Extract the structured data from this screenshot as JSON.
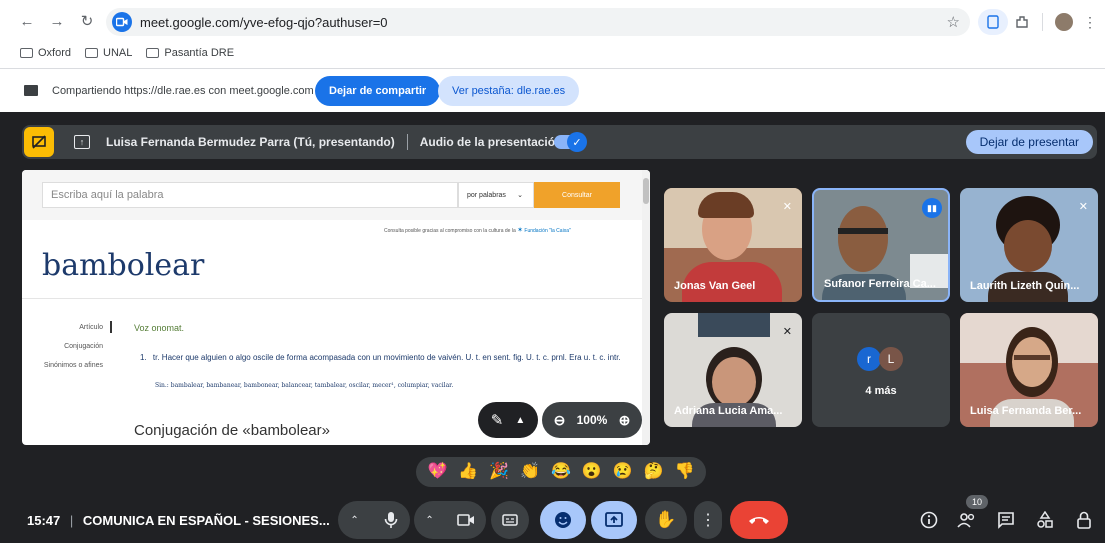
{
  "browser": {
    "url": "meet.google.com/yve-efog-qjo?authuser=0",
    "bookmarks": [
      "Oxford",
      "UNAL",
      "Pasantía DRE"
    ]
  },
  "share_bar": {
    "message": "Compartiendo https://dle.rae.es con meet.google.com",
    "stop_sharing": "Dejar de compartir",
    "view_tab": "Ver pestaña: dle.rae.es"
  },
  "presenting": {
    "presenter": "Luisa Fernanda Bermudez Parra (Tú, presentando)",
    "audio_label": "Audio de la presentación",
    "stop_presenting": "Dejar de presentar"
  },
  "rae": {
    "search_placeholder": "Escriba aquí la palabra",
    "search_mode": "por palabras",
    "consult": "Consultar",
    "sponsor": "Consulta posible gracias al compromiso con la cultura de la",
    "sponsor_name": "Fundación \"la Caixa\"",
    "word": "bambolear",
    "side": [
      "Artículo",
      "Conjugación",
      "Sinónimos o afines"
    ],
    "etymology": "Voz onomat.",
    "def_num": "1.",
    "definition": "tr. Hacer que alguien o algo oscile de forma acompasada con un movimiento de vaivén. U. t. en sent. fig. U. t. c. prnl. Era u. t. c. intr.",
    "synonyms": "Sin.: bambalear, bambanear, bambonear, balancear, tambalear, oscilar, mecer¹, columpiar, vacilar.",
    "conjugation_heading": "Conjugación de «bambolear»",
    "zoom": "100%"
  },
  "participants": [
    {
      "name": "Jonas Van Geel",
      "muted": true
    },
    {
      "name": "Sufanor Ferreira Ca...",
      "speaking": true
    },
    {
      "name": "Laurith Lizeth Quin...",
      "muted": true
    },
    {
      "name": "Adriana Lucia Ama...",
      "muted": true
    },
    {
      "name": "Luisa Fernanda Ber..."
    }
  ],
  "more": {
    "initials": [
      "r",
      "L"
    ],
    "label": "4 más",
    "colors": [
      "#1967d2",
      "#795548"
    ]
  },
  "reactions": [
    "💖",
    "👍",
    "🎉",
    "👏",
    "😂",
    "😮",
    "😢",
    "🤔",
    "👎"
  ],
  "meeting": {
    "time": "15:47",
    "separator": "|",
    "title": "COMUNICA EN ESPAÑOL - SESIONES...",
    "participant_count": "10"
  },
  "colors": {
    "accent": "#1a73e8",
    "presenting_yellow": "#fbbc04",
    "end_call": "#ea4335",
    "active_control": "#a8c7fa"
  }
}
